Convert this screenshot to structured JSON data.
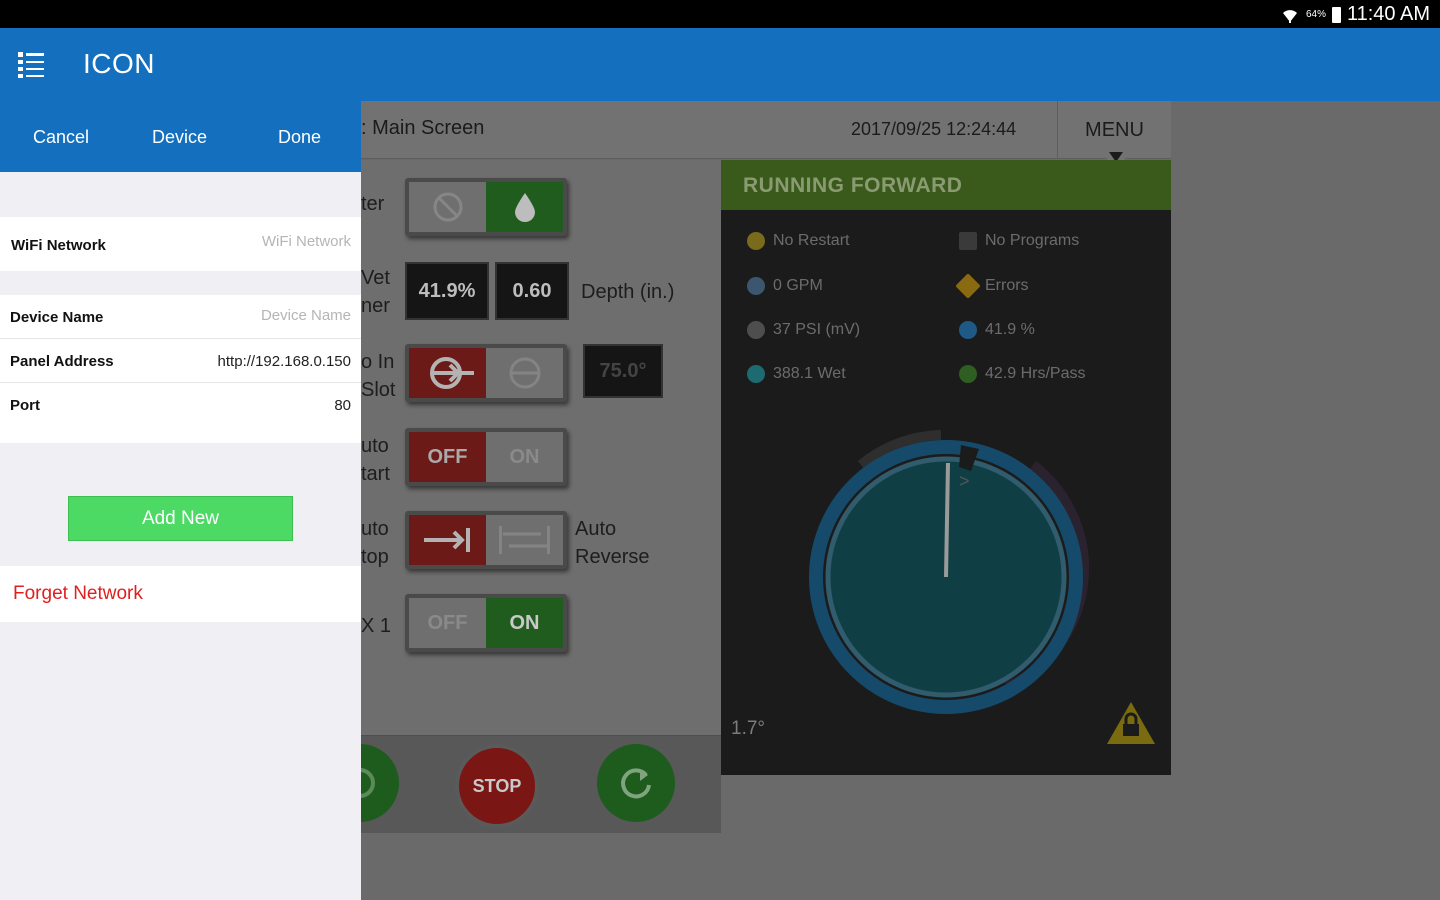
{
  "status_bar": {
    "battery_percent": "64%",
    "time": "11:40 AM"
  },
  "app_bar": {
    "title": "ICON",
    "menu_icon": "list-menu-icon"
  },
  "panel": {
    "toolbar": {
      "cancel_label": "Cancel",
      "device_label": "Device",
      "done_label": "Done"
    },
    "wifi": {
      "label": "WiFi Network",
      "placeholder": "WiFi Network"
    },
    "device": {
      "name_label": "Device Name",
      "name_placeholder": "Device Name",
      "address_label": "Panel Address",
      "address_value": "http://192.168.0.150",
      "port_label": "Port",
      "port_value": "80"
    },
    "add_new_label": "Add New",
    "forget_label": "Forget Network"
  },
  "hmi": {
    "screen_title": ": Main Screen",
    "datetime": "2017/09/25 12:24:44",
    "menu_label": "MENU",
    "controls": {
      "water_label": "ter",
      "wet_label_1": "Vet",
      "wet_label_2": "ner",
      "wet_percent": "41.9%",
      "depth_value": "0.60",
      "depth_label": "Depth (in.)",
      "slot_label_1": "o In",
      "slot_label_2": "Slot",
      "slot_value": "75.0°",
      "autostart_label_1": "uto",
      "autostart_label_2": "tart",
      "autostart_off": "OFF",
      "autostart_on": "ON",
      "autostop_label_1": "uto",
      "autostop_label_2": "top",
      "auto_reverse_1": "Auto",
      "auto_reverse_2": "Reverse",
      "x1_label": "X 1",
      "x1_off": "OFF",
      "x1_on": "ON",
      "stop_label": "STOP"
    },
    "status": {
      "header": "RUNNING FORWARD",
      "no_restart": "No Restart",
      "no_programs": "No Programs",
      "gpm": "0 GPM",
      "errors": "Errors",
      "psi": "37 PSI (mV)",
      "percent": "41.9 %",
      "wet": "388.1 Wet",
      "hrs_pass": "42.9 Hrs/Pass",
      "angle": "1.7°"
    },
    "colors": {
      "status_green": "#3a5a1c",
      "dial_teal": "#1f6f78",
      "dial_blue": "#1e6a9a"
    }
  }
}
